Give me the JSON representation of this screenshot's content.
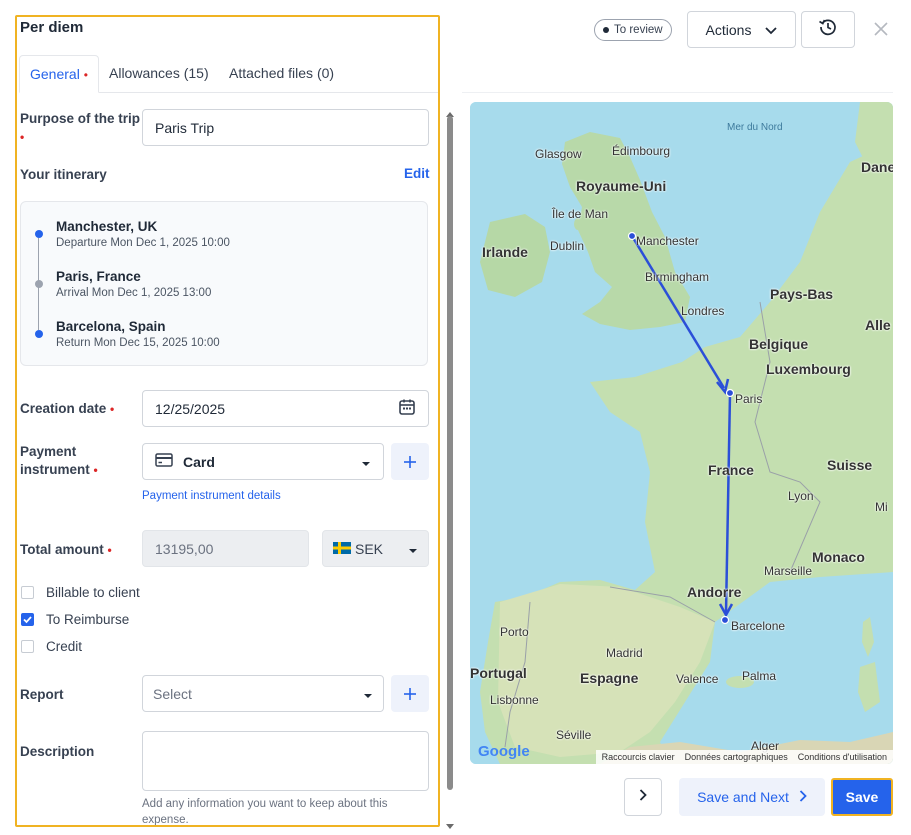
{
  "header": {
    "title": "Per diem",
    "status_badge": "To review",
    "actions_label": "Actions"
  },
  "tabs": [
    {
      "label": "General",
      "required": "•"
    },
    {
      "label": "Allowances (15)"
    },
    {
      "label": "Attached files (0)"
    }
  ],
  "form": {
    "purpose_label": "Purpose of the trip",
    "purpose_value": "Paris Trip",
    "itinerary_label": "Your itinerary",
    "itinerary_edit": "Edit",
    "stops": [
      {
        "name": "Manchester, UK",
        "detail": "Departure Mon Dec 1, 2025 10:00"
      },
      {
        "name": "Paris, France",
        "detail": "Arrival Mon Dec 1, 2025 13:00"
      },
      {
        "name": "Barcelona, Spain",
        "detail": "Return Mon Dec 15, 2025 10:00"
      }
    ],
    "creation_date_label": "Creation date",
    "creation_date_value": "12/25/2025",
    "payment_label_1": "Payment",
    "payment_label_2": "instrument",
    "payment_value": "Card",
    "payment_details_link": "Payment instrument details",
    "total_label": "Total amount",
    "total_value": "13195,00",
    "currency": "SEK",
    "checkboxes": [
      {
        "label": "Billable to client",
        "checked": false
      },
      {
        "label": "To Reimburse",
        "checked": true
      },
      {
        "label": "Credit",
        "checked": false
      }
    ],
    "report_label": "Report",
    "report_placeholder": "Select",
    "description_label": "Description",
    "description_hint": "Add any information you want to keep about this expense.",
    "required_mark": "•"
  },
  "map": {
    "countries": [
      "Royaume-Uni",
      "Irlande",
      "Pays-Bas",
      "Belgique",
      "Luxembourg",
      "France",
      "Suisse",
      "Andorre",
      "Monaco",
      "Portugal",
      "Espagne",
      "Dane",
      "Alle"
    ],
    "cities": [
      "Glasgow",
      "Édimbourg",
      "Île de Man",
      "Dublin",
      "Manchester",
      "Birmingham",
      "Londres",
      "Paris",
      "Lyon",
      "Marseille",
      "Barcelone",
      "Porto",
      "Madrid",
      "Lisbonne",
      "Valence",
      "Palma",
      "Séville",
      "Alger",
      "Mi"
    ],
    "sea": "Mer du Nord",
    "attribution": [
      "Raccourcis clavier",
      "Données cartographiques",
      "Conditions d'utilisation"
    ],
    "google_logo": "Google",
    "route_color": "#2b4fd8"
  },
  "footer": {
    "save_next_label": "Save and Next",
    "save_label": "Save"
  },
  "colors": {
    "accent": "#2563eb",
    "highlight_outline": "#f0b323",
    "required": "#dc2626"
  }
}
